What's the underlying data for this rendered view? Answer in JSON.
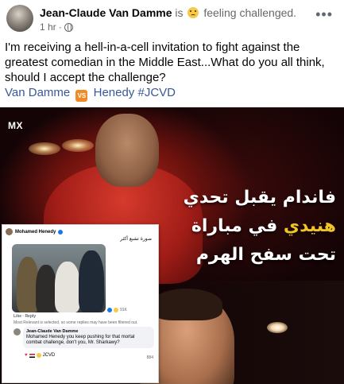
{
  "post": {
    "author": "Jean-Claude Van Damme",
    "is_text": "is",
    "feeling": "feeling challenged.",
    "time": "1 hr",
    "time_sep": "·",
    "more": "•••",
    "text": "I'm receiving a hell-in-a-cell invitation to fight against the greatest comedian in the Middle East...What do you all think, should I accept the challenge?",
    "tags": {
      "left": "Van Damme",
      "vs": "VS",
      "right": "Henedy #JCVD"
    }
  },
  "image": {
    "logo": "MX",
    "arabic_line1": "فاندام يقبل تحدي",
    "arabic_line2_hl": "هنيدي",
    "arabic_line2_rest": "في مباراة",
    "arabic_line3": "تحت سفح الهرم",
    "inset": {
      "name": "Mohamed Henedy",
      "caption": "صورة تشبع أكثر",
      "reactions": "91K",
      "actions": "Like · Reply",
      "filter": "Most Relevant is selected, so some replies may have been filtered out.",
      "reply_name": "Jean-Claude Van Damme",
      "reply_text": "Mohamed Henedy you keep pushing for that mortal combat challenge, don't you, Mr. Sharkawy?",
      "reply_tag": "JCVD",
      "reply_count": "884"
    }
  },
  "colors": {
    "link": "#385898",
    "muted": "#65676b",
    "vs_badge": "#f08a24",
    "arabic_highlight": "#f2c526"
  }
}
